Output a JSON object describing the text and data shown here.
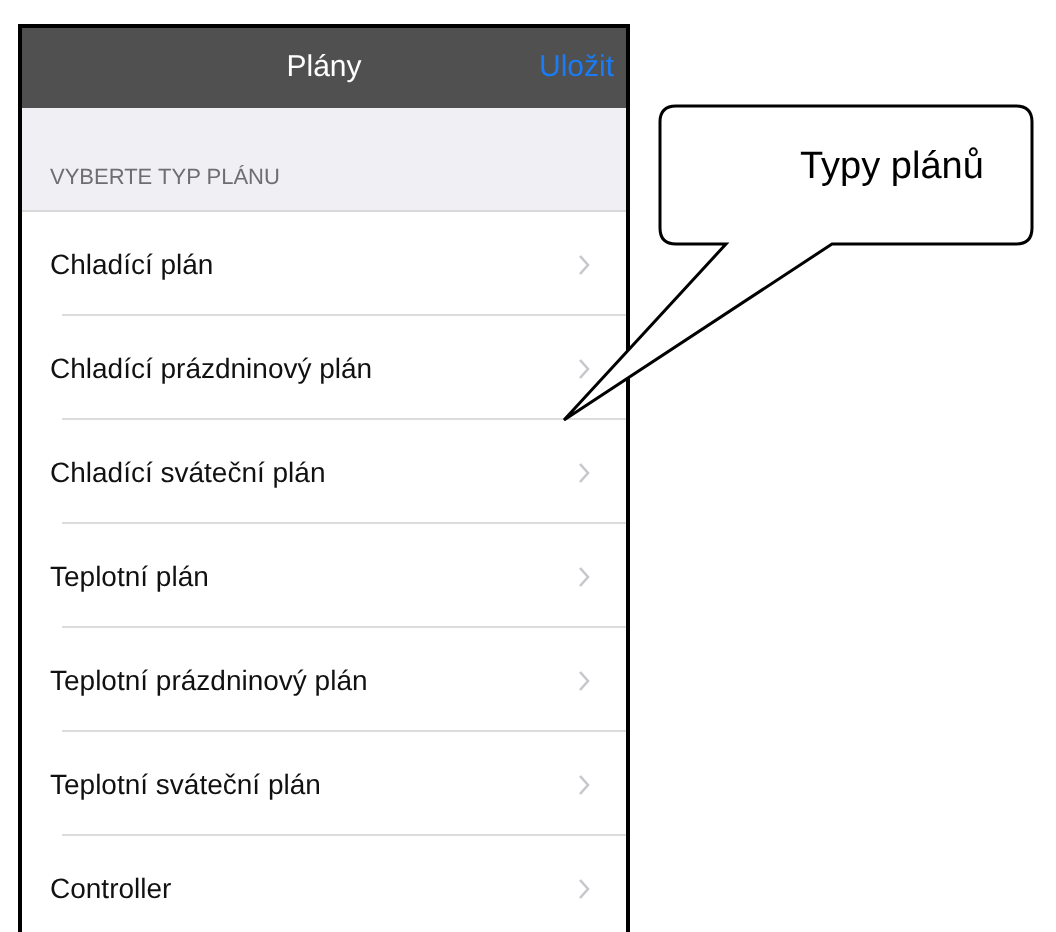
{
  "navbar": {
    "title": "Plány",
    "action": "Uložit"
  },
  "section": {
    "header": "VYBERTE TYP PLÁNU"
  },
  "items": [
    {
      "label": "Chladící plán"
    },
    {
      "label": "Chladící prázdninový plán"
    },
    {
      "label": "Chladící sváteční plán"
    },
    {
      "label": "Teplotní plán"
    },
    {
      "label": "Teplotní prázdninový plán"
    },
    {
      "label": "Teplotní sváteční plán"
    },
    {
      "label": "Controller"
    }
  ],
  "callout": {
    "text": "Typy plánů"
  }
}
